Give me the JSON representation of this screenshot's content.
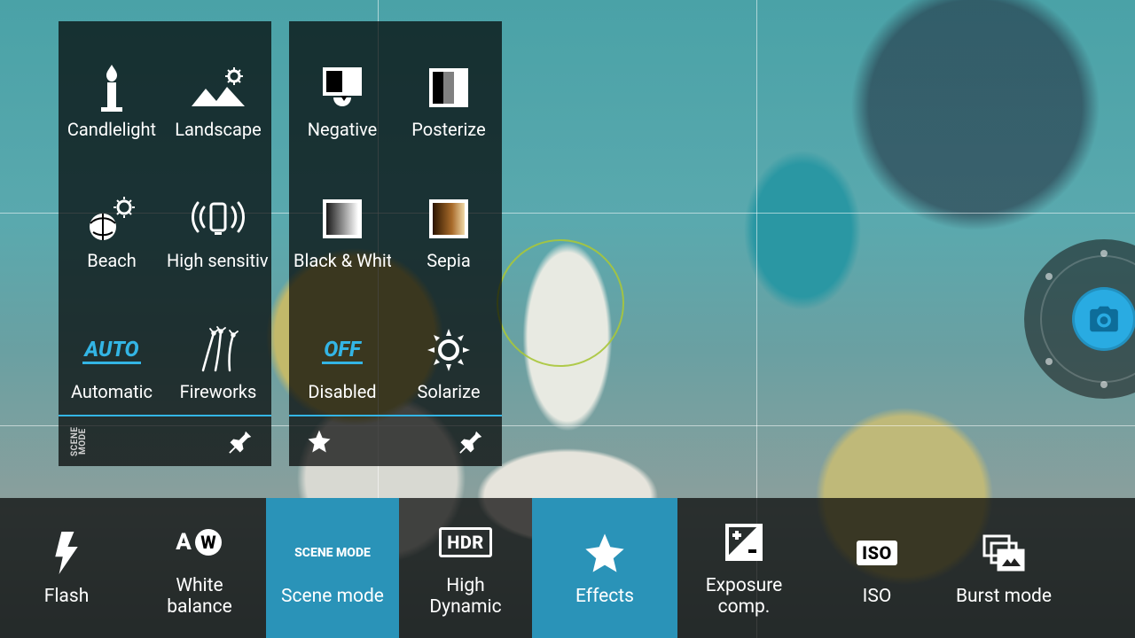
{
  "scene_panel": {
    "tag": "SCENE\nMODE",
    "items": [
      {
        "id": "candlelight",
        "label": "Candlelight",
        "selected": false
      },
      {
        "id": "landscape",
        "label": "Landscape",
        "selected": false
      },
      {
        "id": "beach",
        "label": "Beach",
        "selected": false
      },
      {
        "id": "high-sensitivity",
        "label": "High sensitivity",
        "selected": false
      },
      {
        "id": "automatic",
        "label": "Automatic",
        "selected": true,
        "badge": "AUTO"
      },
      {
        "id": "fireworks",
        "label": "Fireworks",
        "selected": false
      }
    ]
  },
  "effects_panel": {
    "items": [
      {
        "id": "negative",
        "label": "Negative",
        "selected": false
      },
      {
        "id": "posterize",
        "label": "Posterize",
        "selected": false
      },
      {
        "id": "black-white",
        "label": "Black & White",
        "selected": false
      },
      {
        "id": "sepia",
        "label": "Sepia",
        "selected": false
      },
      {
        "id": "disabled",
        "label": "Disabled",
        "selected": true,
        "badge": "OFF"
      },
      {
        "id": "solarize",
        "label": "Solarize",
        "selected": false
      }
    ]
  },
  "toolbar": {
    "items": [
      {
        "id": "flash",
        "label": "Flash",
        "active": false
      },
      {
        "id": "white-balance",
        "label": "White\nbalance",
        "active": false,
        "aw": "A"
      },
      {
        "id": "scene-mode",
        "label": "Scene mode",
        "active": true,
        "badge": "SCENE\nMODE"
      },
      {
        "id": "hdr",
        "label": "High\nDynamic",
        "active": false,
        "badge": "HDR"
      },
      {
        "id": "effects",
        "label": "Effects",
        "active": true
      },
      {
        "id": "exposure",
        "label": "Exposure\ncomp.",
        "active": false
      },
      {
        "id": "iso",
        "label": "ISO",
        "active": false,
        "badge": "ISO"
      },
      {
        "id": "burst",
        "label": "Burst mode",
        "active": false
      }
    ]
  }
}
